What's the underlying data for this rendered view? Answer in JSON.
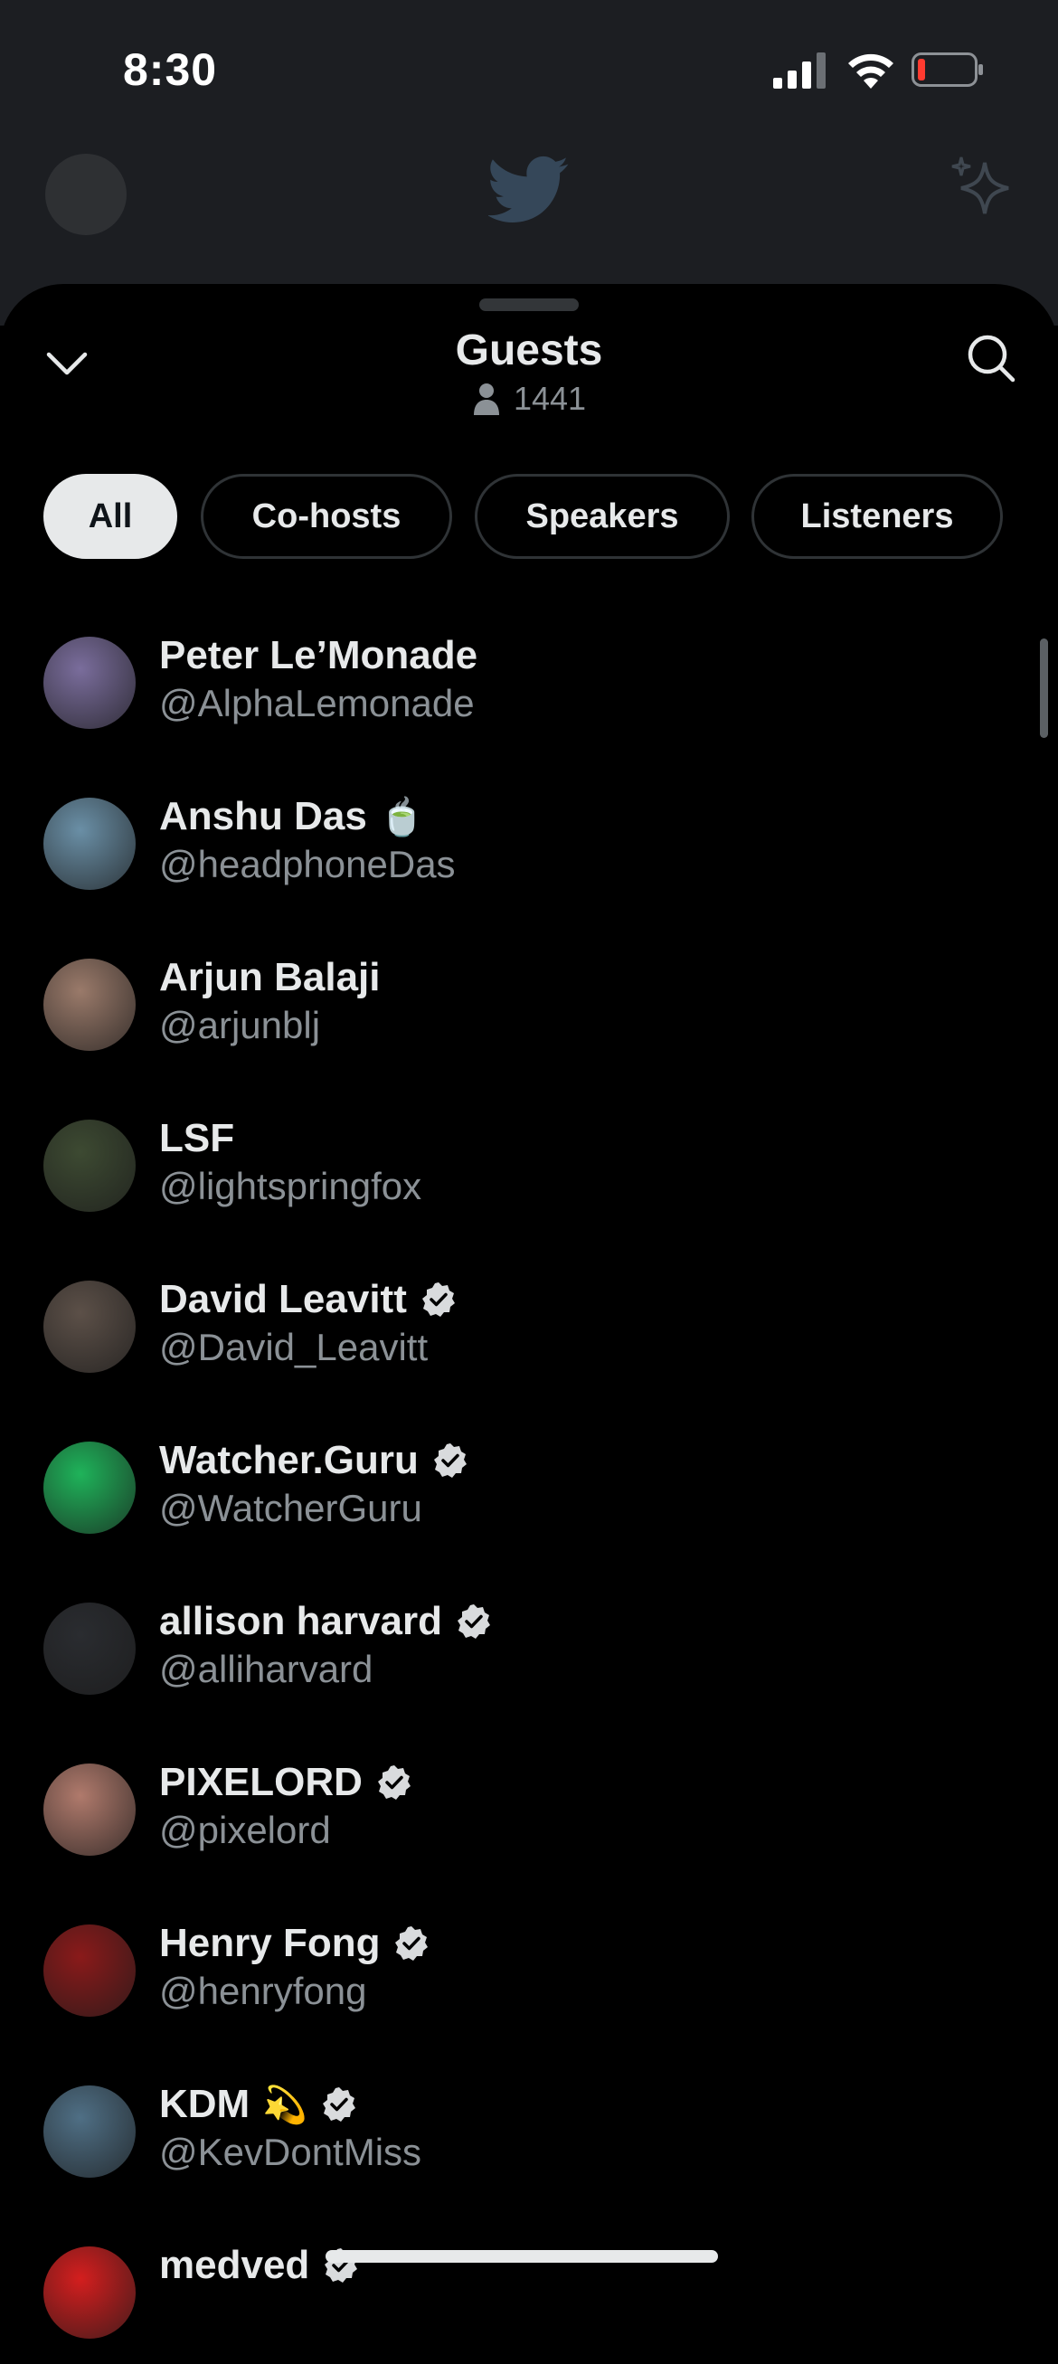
{
  "status": {
    "time": "8:30"
  },
  "sheet": {
    "title": "Guests",
    "count": "1441"
  },
  "tabs": [
    {
      "label": "All",
      "active": true
    },
    {
      "label": "Co-hosts",
      "active": false
    },
    {
      "label": "Speakers",
      "active": false
    },
    {
      "label": "Listeners",
      "active": false
    }
  ],
  "guests": [
    {
      "name": "Peter Le’Monade",
      "handle": "@AlphaLemonade",
      "verified": false,
      "emoji": "",
      "avatar_color": "#7a6d9c"
    },
    {
      "name": "Anshu Das",
      "handle": "@headphoneDas",
      "verified": false,
      "emoji": "🍵",
      "avatar_color": "#6a8fa6"
    },
    {
      "name": "Arjun Balaji",
      "handle": "@arjunblj",
      "verified": false,
      "emoji": "",
      "avatar_color": "#9a7a6a"
    },
    {
      "name": "LSF",
      "handle": "@lightspringfox",
      "verified": false,
      "emoji": "",
      "avatar_color": "#3d4a32"
    },
    {
      "name": "David Leavitt",
      "handle": "@David_Leavitt",
      "verified": true,
      "emoji": "",
      "avatar_color": "#5c5048"
    },
    {
      "name": "Watcher.Guru",
      "handle": "@WatcherGuru",
      "verified": true,
      "emoji": "",
      "avatar_color": "#1fb35a"
    },
    {
      "name": "allison harvard",
      "handle": "@alliharvard",
      "verified": true,
      "emoji": "",
      "avatar_color": "#2a2c30"
    },
    {
      "name": "PIXELORD",
      "handle": "@pixelord",
      "verified": true,
      "emoji": "",
      "avatar_color": "#b07a6c"
    },
    {
      "name": "Henry Fong",
      "handle": "@henryfong",
      "verified": true,
      "emoji": "",
      "avatar_color": "#8a1a1a"
    },
    {
      "name": "KDM",
      "handle": "@KevDontMiss",
      "verified": true,
      "emoji": "💫",
      "avatar_color": "#4f6f85"
    },
    {
      "name": "medved",
      "handle": "",
      "verified": true,
      "emoji": "",
      "avatar_color": "#d41e1e"
    }
  ],
  "icons": {
    "collapse": "chevron-down-icon",
    "search": "search-icon",
    "listeners": "person-icon",
    "verified": "verified-badge-icon"
  }
}
